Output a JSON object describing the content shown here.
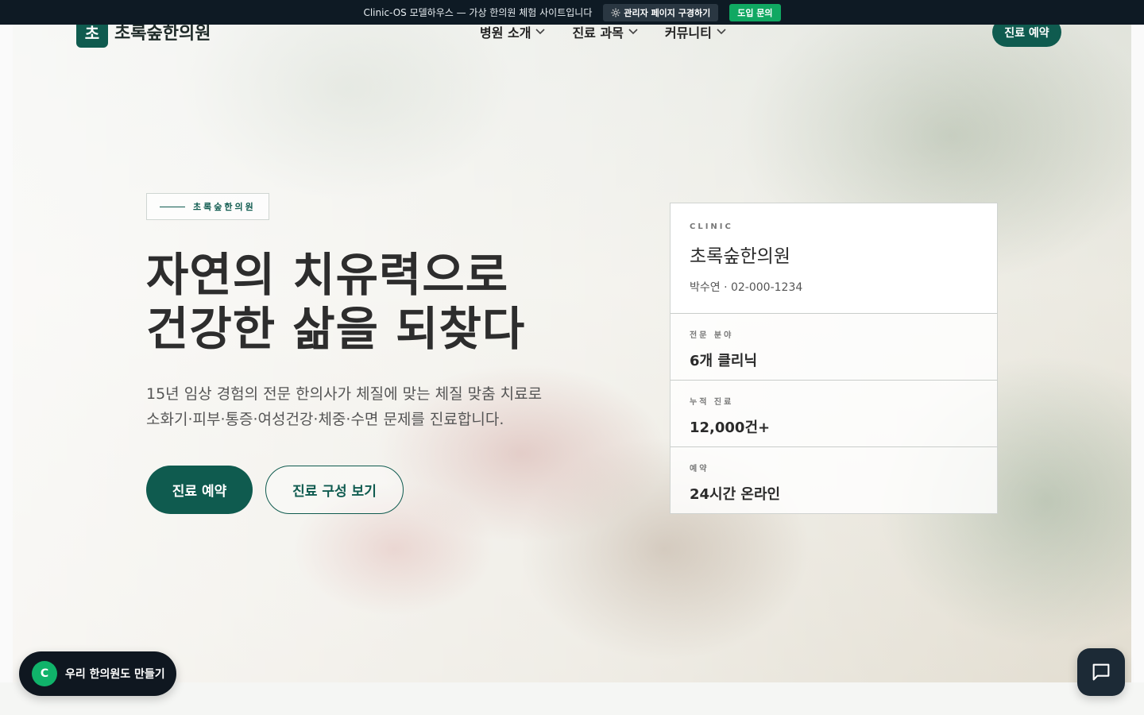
{
  "announce": {
    "text": "Clinic-OS 모델하우스 — 가상 한의원 체험 사이트입니다",
    "admin_button": "관리자 페이지 구경하기",
    "admin_icon": "gear-icon",
    "inquiry_button": "도입 문의"
  },
  "header": {
    "logo_mark": "초",
    "logo_text": "초록숲한의원",
    "nav": [
      {
        "label": "병원 소개"
      },
      {
        "label": "진료 과목"
      },
      {
        "label": "커뮤니티"
      }
    ],
    "reserve_button": "진료 예약"
  },
  "hero": {
    "eyebrow": "초록숲한의원",
    "headline_line1": "자연의 치유력으로",
    "headline_line2": "건강한 삶을 되찾다",
    "sub_line1": "15년 임상 경험의 전문 한의사가 체질에 맞는 체질 맞춤 치료로",
    "sub_line2": "소화기·피부·통증·여성건강·체중·수면 문제를 진료합니다.",
    "primary_button": "진료 예약",
    "secondary_button": "진료 구성 보기"
  },
  "card": {
    "label": "CLINIC",
    "name": "초록숲한의원",
    "contact": "박수연 · 02-000-1234",
    "stats": [
      {
        "label": "전문 분야",
        "value": "6개 클리닉"
      },
      {
        "label": "누적 진료",
        "value": "12,000건+"
      },
      {
        "label": "예약",
        "value": "24시간 온라인"
      }
    ]
  },
  "widgets": {
    "builder_badge": "C",
    "builder_text": "우리 한의원도 만들기",
    "chat_icon": "chat-icon"
  },
  "colors": {
    "brand": "#0f5b4f",
    "announce_bg": "#0e1a24",
    "inquiry": "#10a862"
  }
}
